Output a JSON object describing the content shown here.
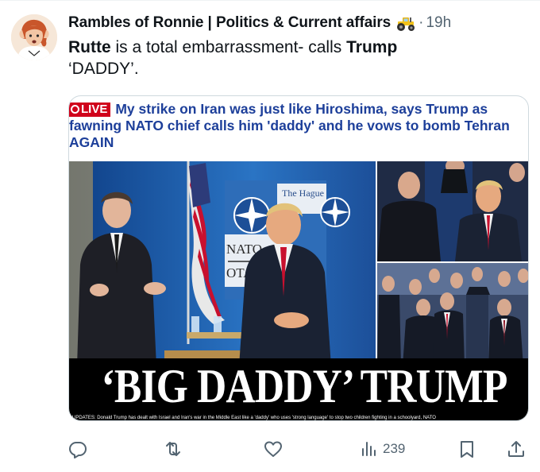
{
  "post": {
    "author_name": "Rambles of Ronnie | Politics & Current affairs",
    "author_emoji": "tractor-icon",
    "separator": "·",
    "time": "19h",
    "text_part1": "Rutte",
    "text_part2": " is a total embarrassment- calls ",
    "text_part3": "Trump",
    "text_part4": "‘DADDY’."
  },
  "card": {
    "live_label": "LIVE",
    "headline_text": "My strike on Iran was just like Hiroshima, says Trump as fawning NATO chief calls him 'daddy' and he vows to bomb Tehran AGAIN",
    "banner_text": "‘BIG DADDY’ TRUMP",
    "banner_subtext": "UPDATES: Donald Trump has dealt with Israel and Iran's war in the Middle East like a 'daddy' who uses 'strong language' to stop two children fighting in a schoolyard, NATO",
    "sign_text_1": "The Hague",
    "sign_text_2": "NATO",
    "sign_text_3": "OTAN"
  },
  "actions": {
    "reply_icon": "reply-icon",
    "retweet_icon": "retweet-icon",
    "like_icon": "heart-icon",
    "views_icon": "views-icon",
    "views_count": "239",
    "bookmark_icon": "bookmark-icon",
    "share_icon": "share-icon"
  },
  "colors": {
    "headline_blue": "#1d3f9a",
    "live_red": "#d0021b",
    "secondary_text": "#536471",
    "border": "#cfd9de"
  }
}
